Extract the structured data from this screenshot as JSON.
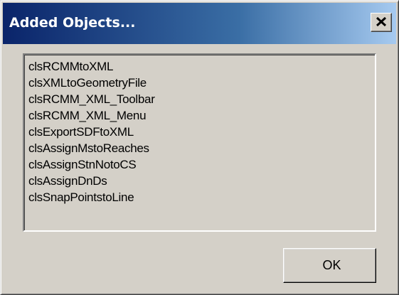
{
  "window": {
    "title": "Added Objects...",
    "close_icon": "close-x-icon"
  },
  "list": {
    "items": [
      "clsRCMMtoXML",
      "clsXMLtoGeometryFile",
      "clsRCMM_XML_Toolbar",
      "clsRCMM_XML_Menu",
      "clsExportSDFtoXML",
      "clsAssignMstoReaches",
      "clsAssignStnNotoCS",
      "clsAssignDnDs",
      "clsSnapPointstoLine"
    ]
  },
  "buttons": {
    "ok_label": "OK"
  },
  "colors": {
    "title_start": "#0a246a",
    "title_end": "#a6caf0",
    "face": "#d4d0c8"
  }
}
